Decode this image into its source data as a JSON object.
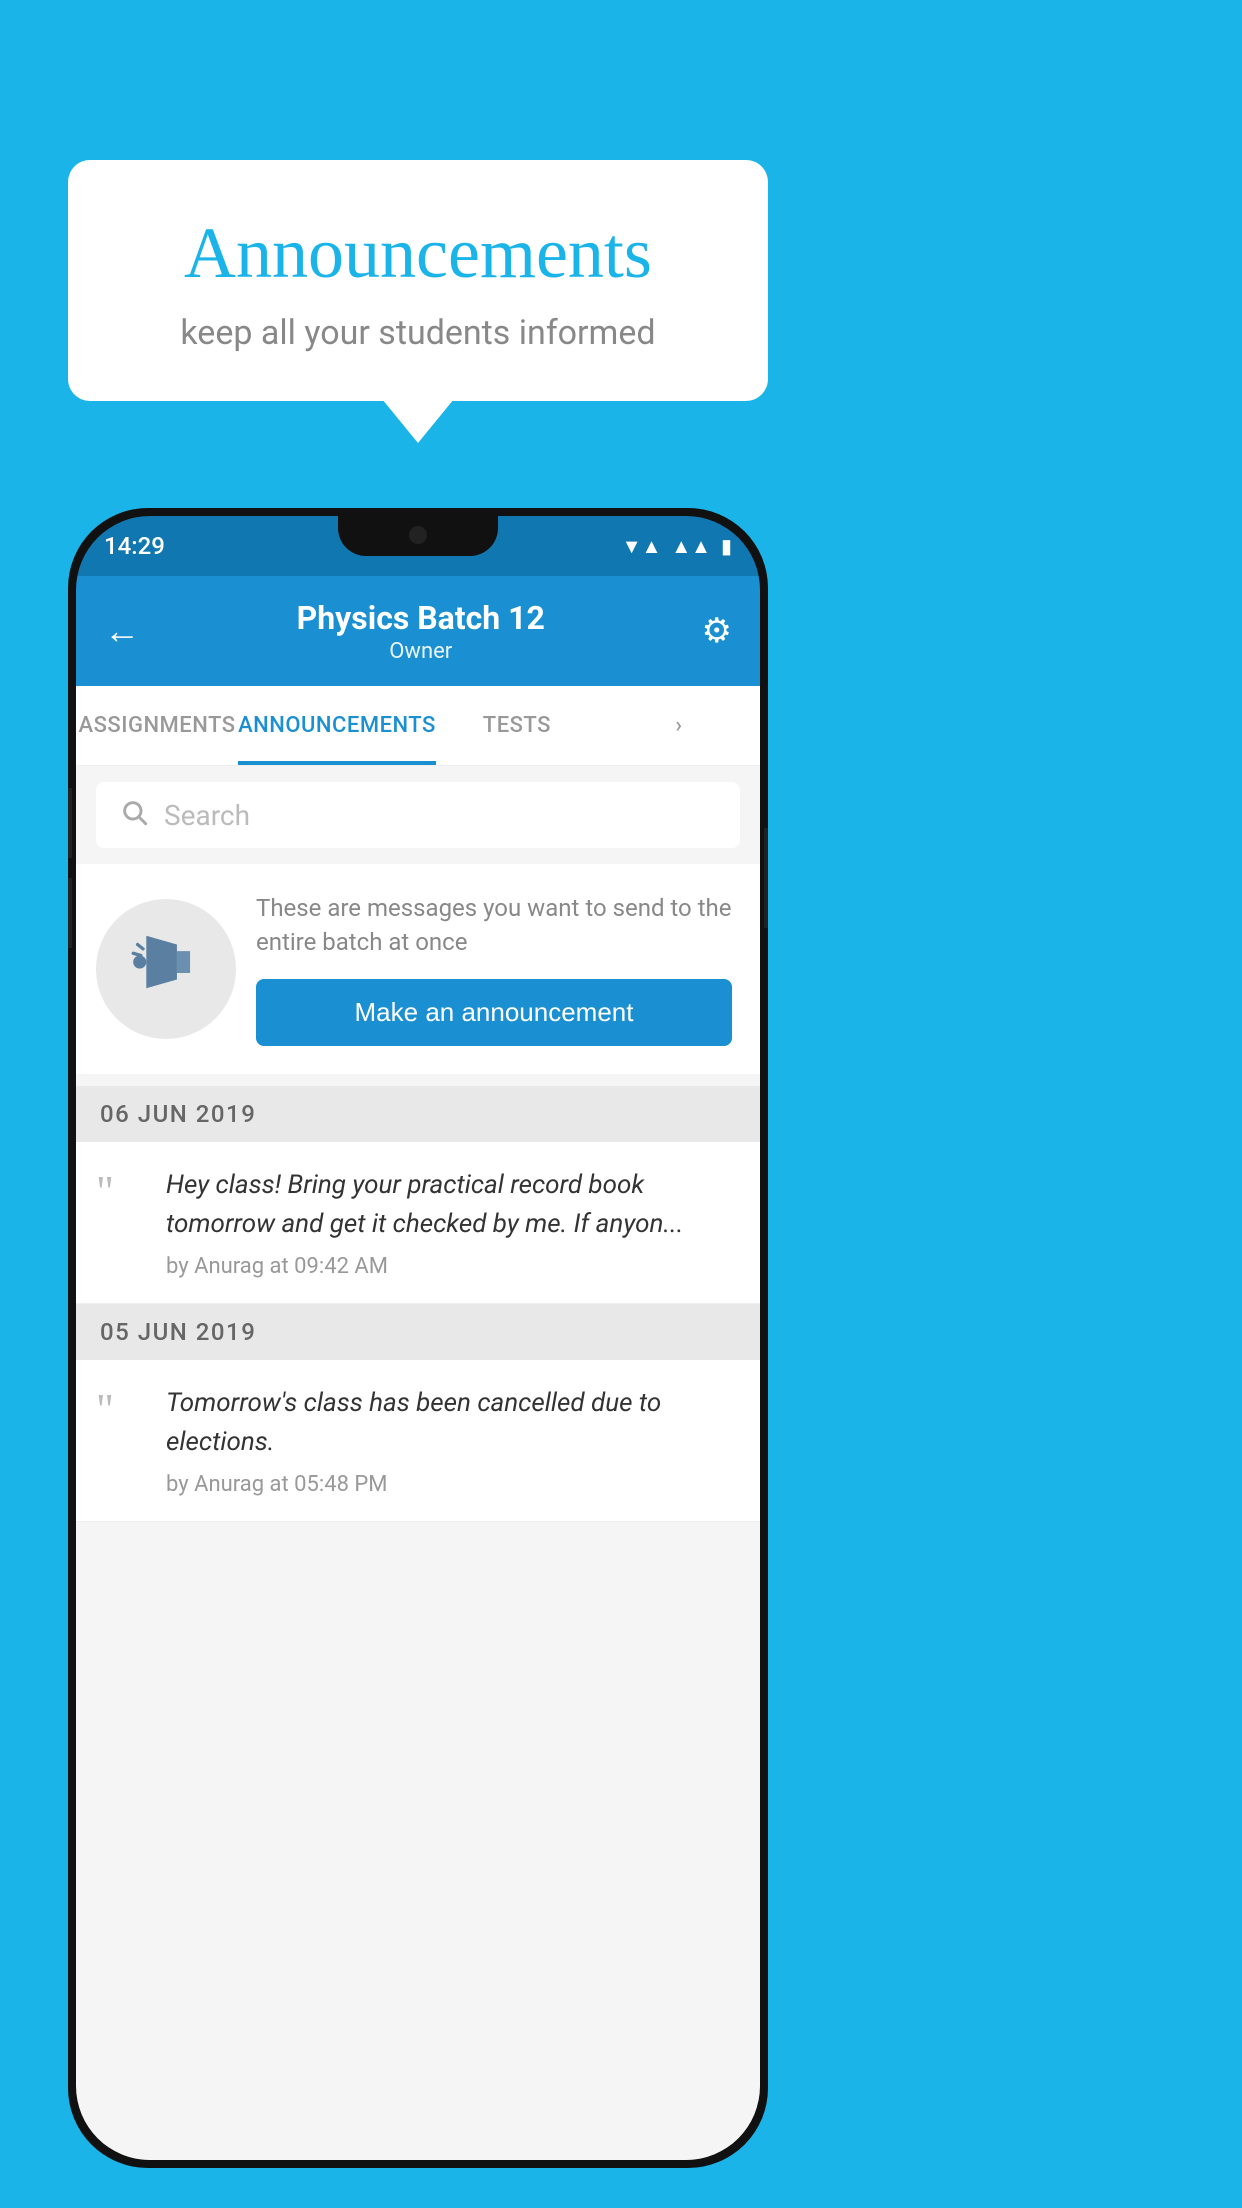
{
  "background_color": "#1ab4e8",
  "bubble": {
    "title": "Announcements",
    "subtitle": "keep all your students informed"
  },
  "phone": {
    "status_bar": {
      "time": "14:29",
      "icons": [
        "wifi",
        "signal",
        "battery"
      ]
    },
    "app_bar": {
      "back_arrow": "←",
      "title": "Physics Batch 12",
      "subtitle": "Owner",
      "gear_icon": "⚙"
    },
    "tabs": [
      {
        "label": "ASSIGNMENTS",
        "active": false
      },
      {
        "label": "ANNOUNCEMENTS",
        "active": true
      },
      {
        "label": "TESTS",
        "active": false
      },
      {
        "label": "›",
        "active": false
      }
    ],
    "search": {
      "placeholder": "Search"
    },
    "promo": {
      "description": "These are messages you want to send to the entire batch at once",
      "button_label": "Make an announcement"
    },
    "announcements": [
      {
        "date": "06  JUN  2019",
        "text": "Hey class! Bring your practical record book tomorrow and get it checked by me. If anyon...",
        "meta": "by Anurag at 09:42 AM"
      },
      {
        "date": "05  JUN  2019",
        "text": "Tomorrow's class has been cancelled due to elections.",
        "meta": "by Anurag at 05:48 PM"
      }
    ]
  }
}
